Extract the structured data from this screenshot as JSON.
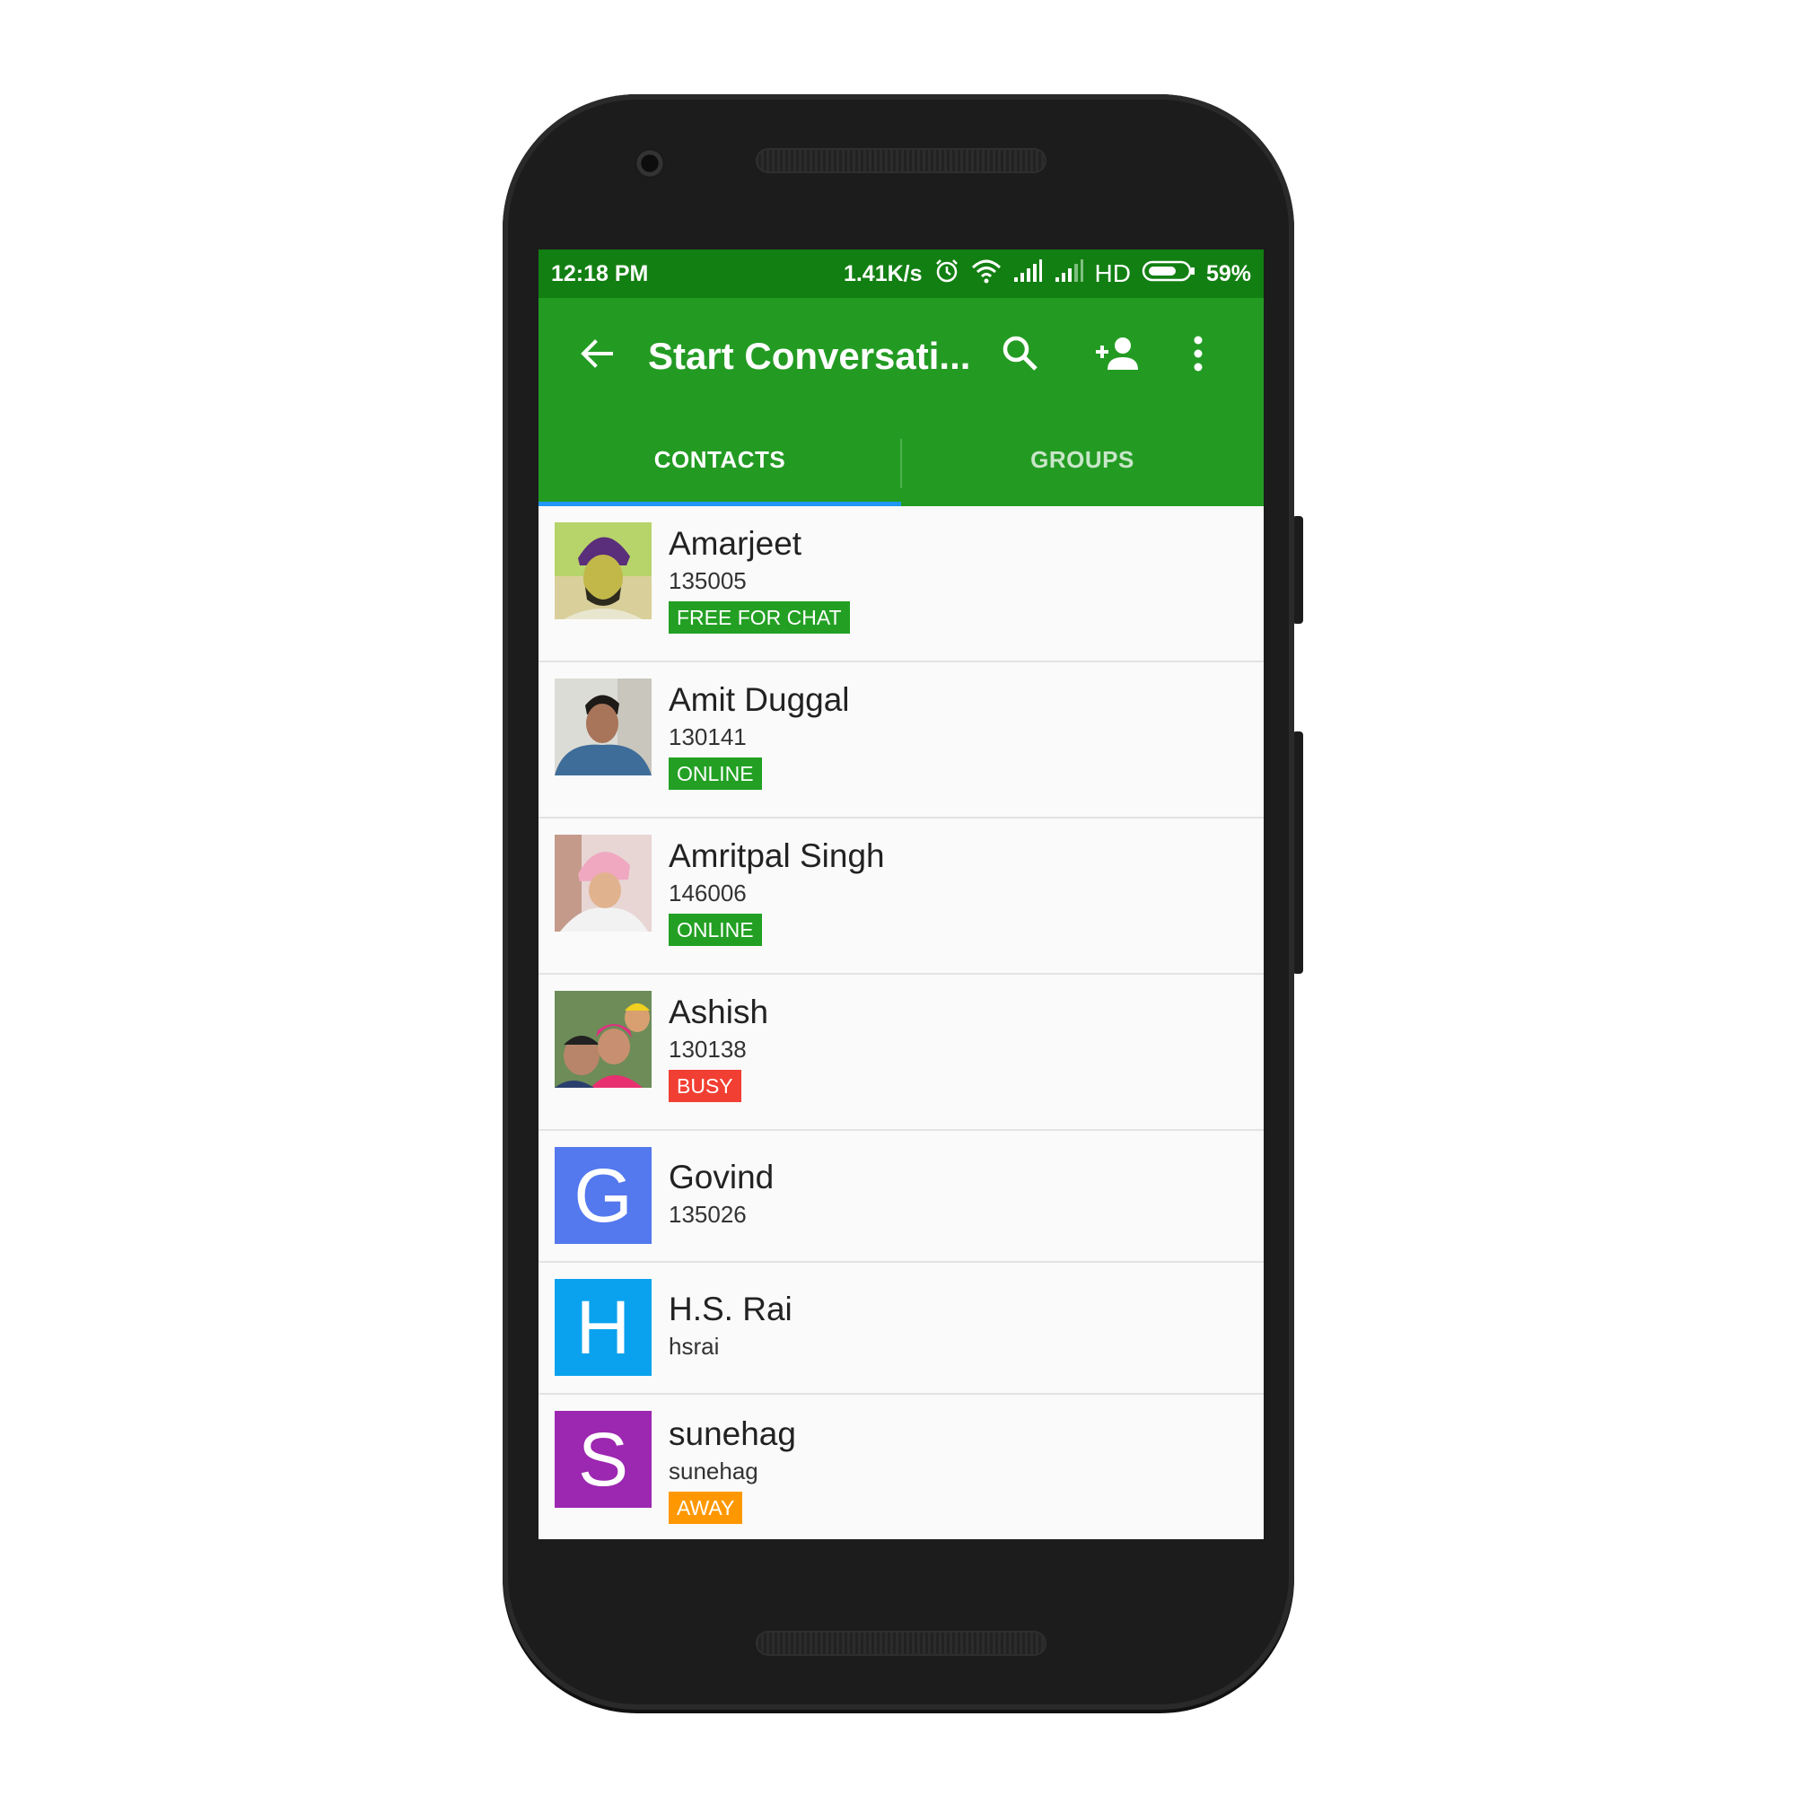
{
  "statusbar": {
    "time": "12:18 PM",
    "speed": "1.41K/s",
    "network_label": "HD",
    "battery": "59%",
    "icons": [
      "alarm-icon",
      "wifi-icon",
      "signal-icon",
      "signal-2-icon",
      "battery-icon"
    ]
  },
  "appbar": {
    "title": "Start Conversati...",
    "icons": [
      "back-arrow-icon",
      "search-icon",
      "add-contact-icon",
      "more-vert-icon"
    ]
  },
  "tabs": [
    {
      "label": "CONTACTS",
      "active": true
    },
    {
      "label": "GROUPS",
      "active": false
    }
  ],
  "colors": {
    "statusbar": "#127f12",
    "appbar": "#239b23",
    "tab_indicator": "#2196f3",
    "badge_green": "#23a023",
    "badge_red": "#f23f33",
    "badge_orange": "#ff9800"
  },
  "contacts": [
    {
      "name": "Amarjeet",
      "id": "135005",
      "status": "FREE FOR CHAT",
      "status_color": "green",
      "avatar": "photo"
    },
    {
      "name": "Amit Duggal",
      "id": "130141",
      "status": "ONLINE",
      "status_color": "green",
      "avatar": "photo"
    },
    {
      "name": "Amritpal Singh",
      "id": "146006",
      "status": "ONLINE",
      "status_color": "green",
      "avatar": "photo"
    },
    {
      "name": "Ashish",
      "id": "130138",
      "status": "BUSY",
      "status_color": "red",
      "avatar": "photo"
    },
    {
      "name": "Govind",
      "id": "135026",
      "status": "",
      "avatar": "letter",
      "letter": "G",
      "avatar_color": "#5478ee"
    },
    {
      "name": "H.S. Rai",
      "id": "hsrai",
      "status": "",
      "avatar": "letter",
      "letter": "H",
      "avatar_color": "#0aa2ee"
    },
    {
      "name": "sunehag",
      "id": "sunehag",
      "status": "AWAY",
      "status_color": "orange",
      "avatar": "letter",
      "letter": "S",
      "avatar_color": "#9c27b0"
    }
  ]
}
